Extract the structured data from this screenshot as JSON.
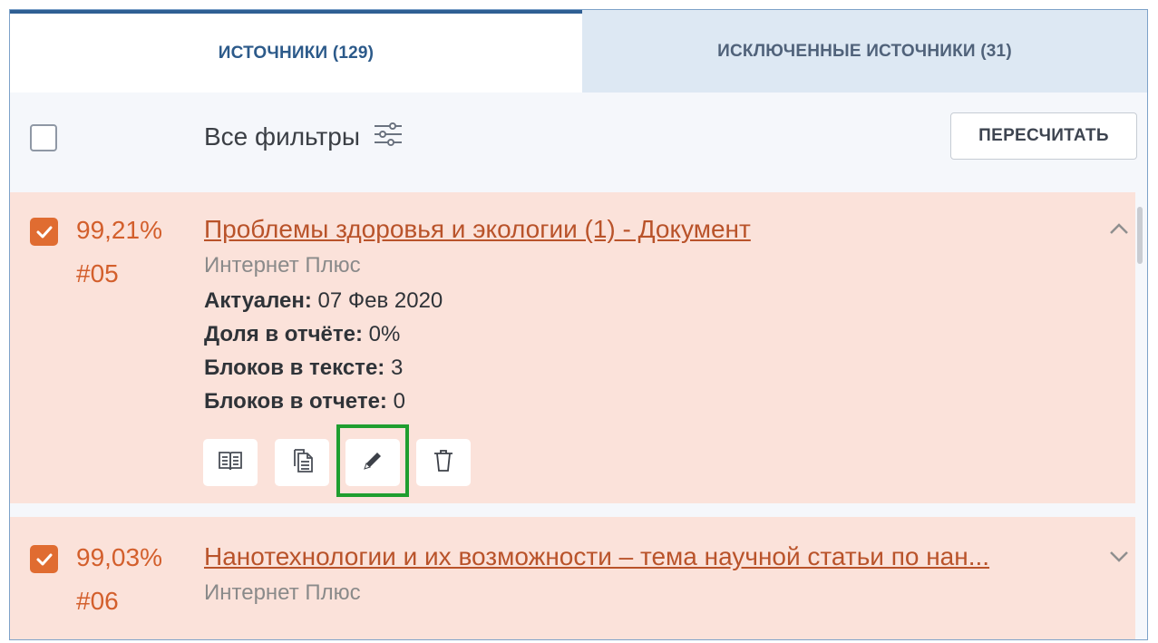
{
  "tabs": {
    "sources": "ИСТОЧНИКИ (129)",
    "excluded": "ИСКЛЮЧЕННЫЕ ИСТОЧНИКИ (31)"
  },
  "toolbar": {
    "filters_label": "Все фильтры",
    "filters_icon": "sliders-icon",
    "recalc_label": "ПЕРЕСЧИТАТЬ"
  },
  "sources": [
    {
      "checked": true,
      "percent": "99,21%",
      "number": "#05",
      "title": "Проблемы здоровья и экологии (1) - Документ",
      "provider": "Интернет Плюс",
      "expanded": true,
      "details": [
        {
          "label": "Актуален:",
          "value": " 07 Фев 2020"
        },
        {
          "label": "Доля в отчёте:",
          "value": " 0%"
        },
        {
          "label": "Блоков в тексте:",
          "value": " 3"
        },
        {
          "label": "Блоков в отчете:",
          "value": " 0"
        }
      ],
      "actions": [
        "book-icon",
        "copy-document-icon",
        "pencil-icon",
        "trash-icon"
      ]
    },
    {
      "checked": true,
      "percent": "99,03%",
      "number": "#06",
      "title": "Нанотехнологии и их возможности – тема научной статьи по нан...",
      "provider": "Интернет Плюс",
      "expanded": false
    }
  ],
  "colors": {
    "accent": "#e06c31",
    "row_bg": "#fbe2da",
    "tab_active_text": "#2c5a8a",
    "highlight": "#1f9e2f"
  }
}
